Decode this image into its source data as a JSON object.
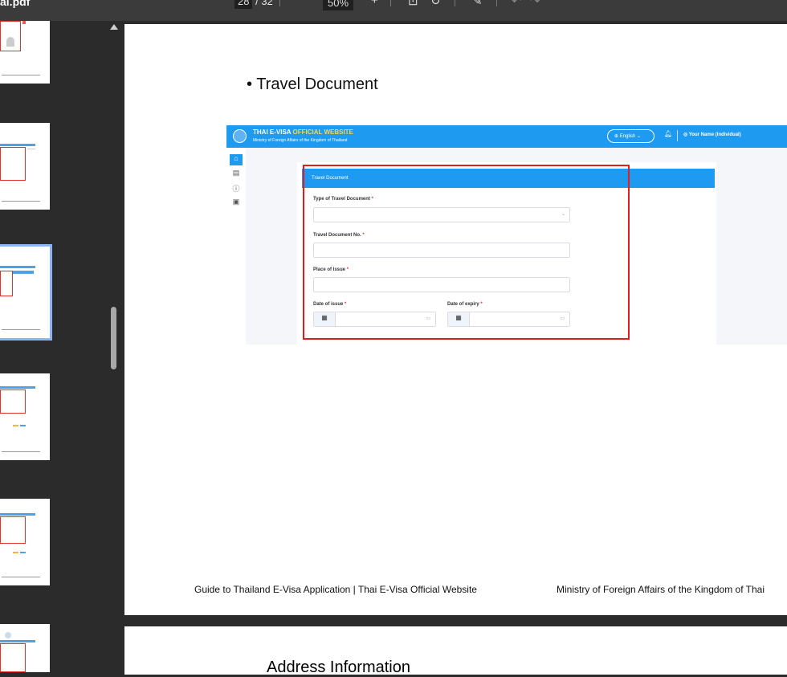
{
  "toolbar": {
    "file_name": "al.pdf",
    "current_page": "28",
    "page_total": "/ 32",
    "zoom": "50%",
    "plus": "+",
    "fit_icon": "fit-page-icon",
    "rotate_icon": "rotate-icon",
    "draw_icon": "draw-icon",
    "undo_icon": "undo-icon",
    "redo_icon": "redo-icon"
  },
  "page": {
    "bullet": "• Travel Document",
    "footer_left": "Guide to Thailand E-Visa Application | Thai E-Visa Official Website",
    "footer_right": "Ministry of Foreign Affairs of the Kingdom of Thai",
    "next_page_title": "Address Information"
  },
  "screenshot": {
    "brand_main": "THAI E-VISA ",
    "brand_accent": "OFFICIAL WEBSITE",
    "brand_sub": "Ministry of Foreign Affairs of the Kingdom of Thailand",
    "language": "⊕ English ⌄",
    "bell": "♫",
    "user": "◎  Your Name  (Individual)",
    "card_title": "Travel Document",
    "req_mark": " *",
    "fields": {
      "type_label": "Type of Travel Document",
      "number_label": "Travel Document No.",
      "place_label": "Place of Issue",
      "issue_label": "Date of issue",
      "expiry_label": "Date of expiry"
    }
  },
  "colors": {
    "brand_blue": "#1e9bf0",
    "highlight_red": "#e01e1e",
    "accent_yellow": "#ffd34d"
  }
}
